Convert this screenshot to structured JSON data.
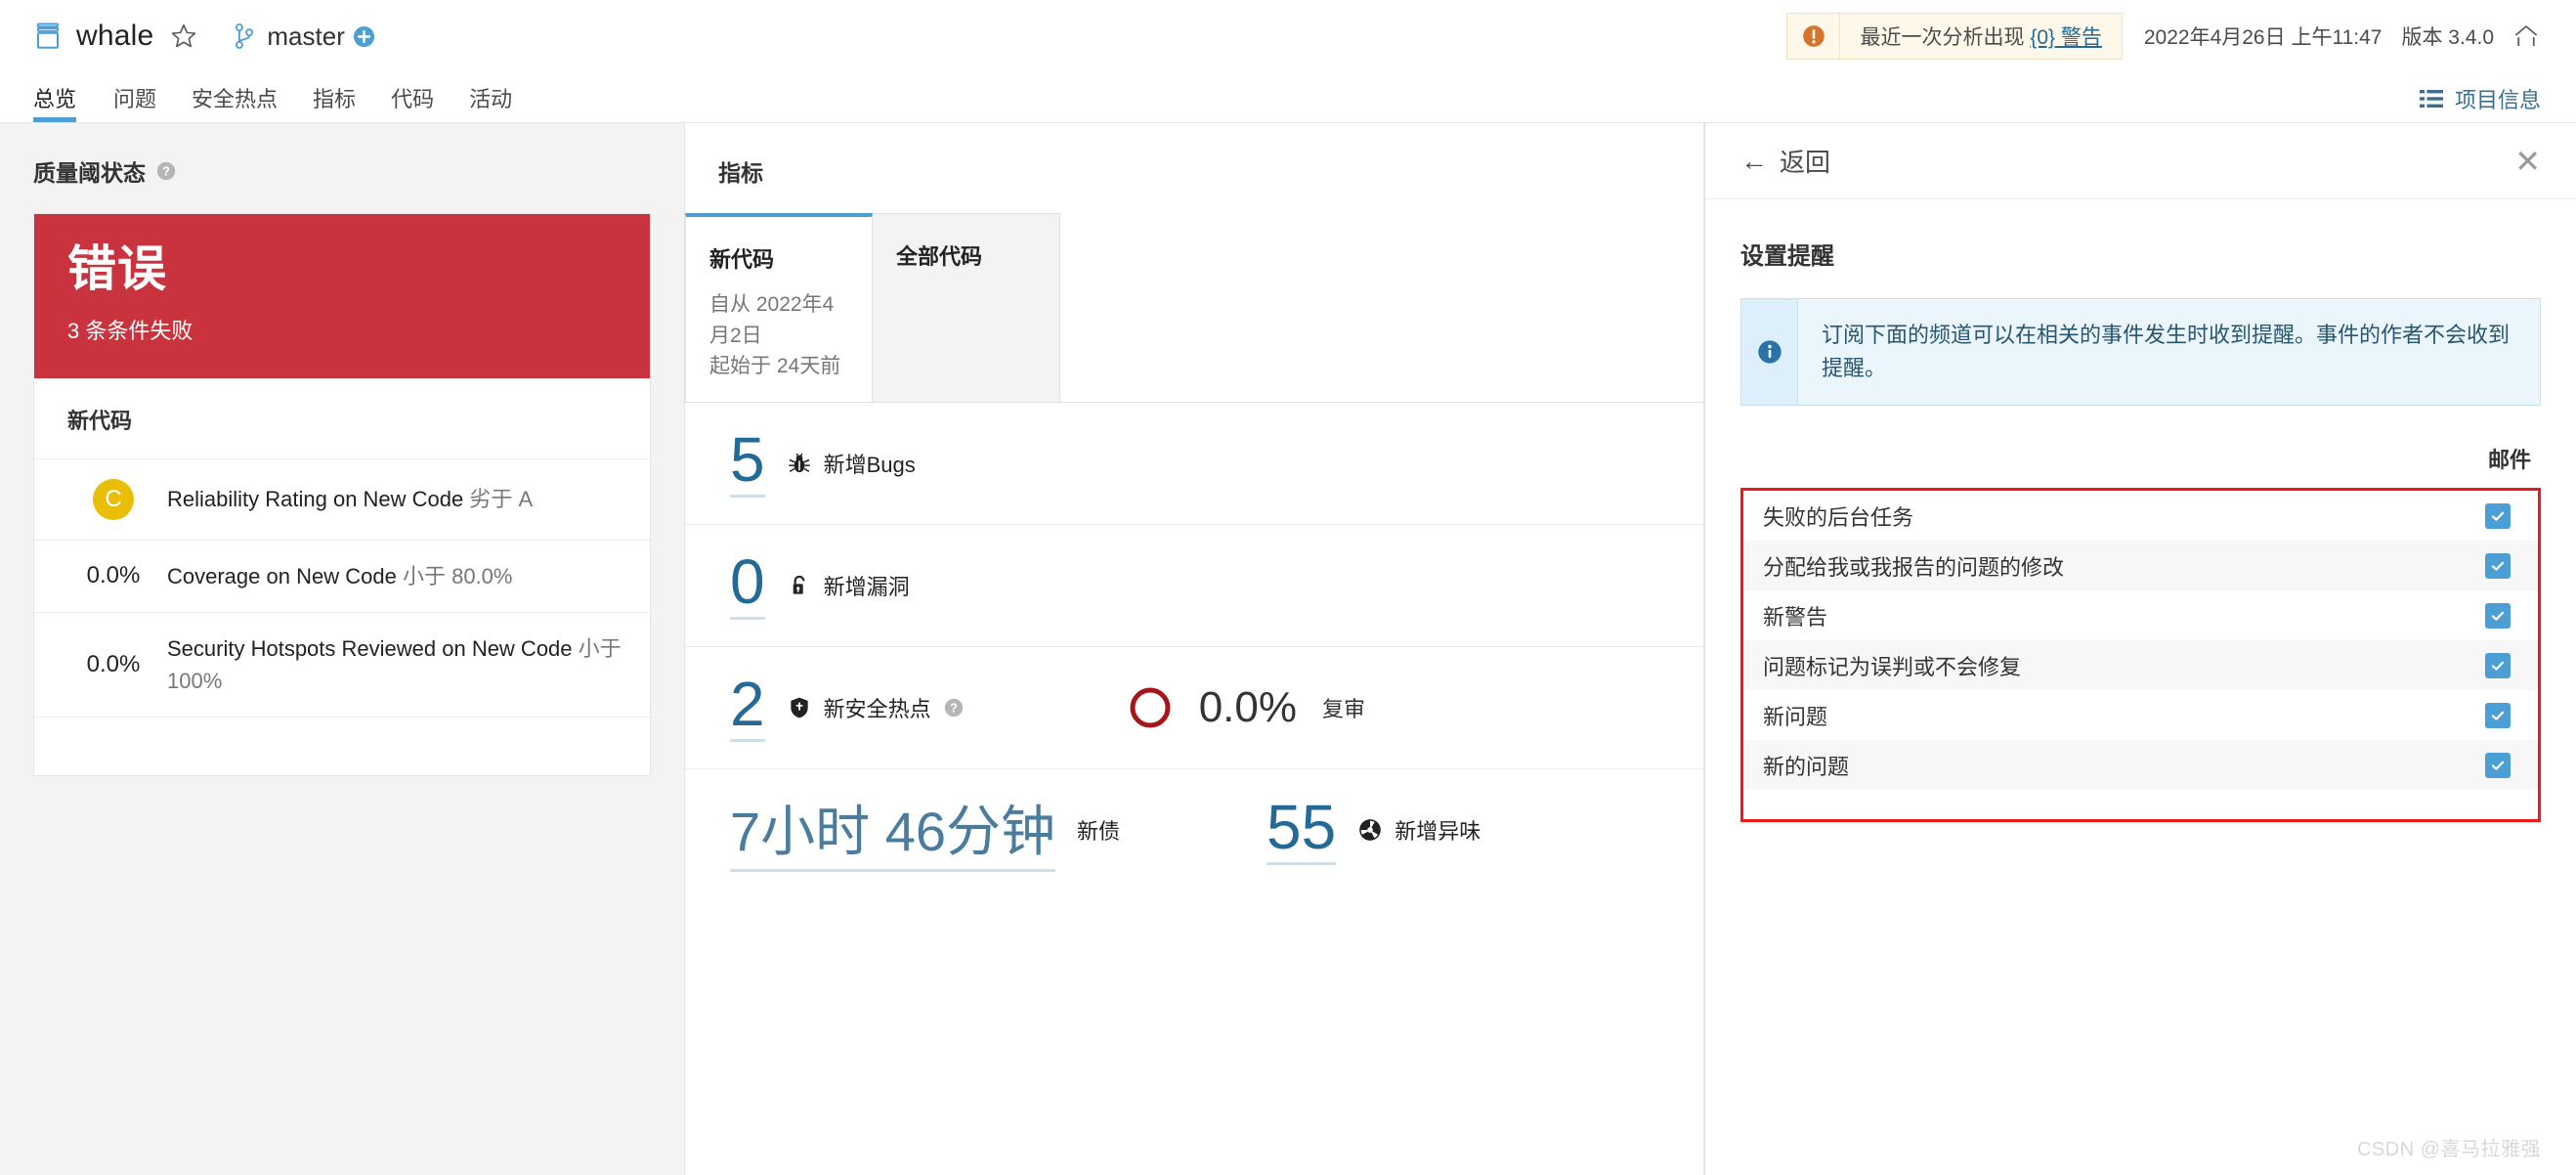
{
  "header": {
    "project_icon": "project-icon",
    "project_name": "whale",
    "favorite_icon": "star-icon",
    "branch_icon": "branch-icon",
    "branch_name": "master",
    "add_icon": "plus-circle-icon",
    "warning_icon": "warning-icon",
    "warning_text_prefix": "最近一次分析出现 ",
    "warning_link": "{0} 警告",
    "analysis_date": "2022年4月26日 上午11:47",
    "version_label": "版本 3.4.0",
    "home_icon": "home-icon"
  },
  "nav": {
    "tabs": [
      {
        "label": "总览",
        "active": true
      },
      {
        "label": "问题",
        "active": false
      },
      {
        "label": "安全热点",
        "active": false
      },
      {
        "label": "指标",
        "active": false
      },
      {
        "label": "代码",
        "active": false
      },
      {
        "label": "活动",
        "active": false
      }
    ],
    "project_info_label": "项目信息",
    "project_info_icon": "list-icon"
  },
  "quality_gate": {
    "section_title": "质量阈状态",
    "help_icon": "help-icon",
    "status": "错误",
    "status_color": "#c9333e",
    "failed_summary": "3 条条件失败",
    "group_title": "新代码",
    "conditions": [
      {
        "value": "C",
        "value_type": "rating",
        "rating_color": "#eabe06",
        "metric": "Reliability Rating on New Code",
        "operator": "劣于",
        "threshold": "A"
      },
      {
        "value": "0.0%",
        "value_type": "number",
        "metric": "Coverage on New Code",
        "operator": "小于",
        "threshold": "80.0%"
      },
      {
        "value": "0.0%",
        "value_type": "number",
        "metric": "Security Hotspots Reviewed on New Code",
        "operator": "小于",
        "threshold": "100%"
      }
    ]
  },
  "measures": {
    "section_title": "指标",
    "period_tabs": [
      {
        "title": "新代码",
        "line1": "自从 2022年4月2日",
        "line2": "起始于 24天前",
        "active": true
      },
      {
        "title": "全部代码",
        "line1": "",
        "line2": "",
        "active": false
      }
    ],
    "rows": [
      {
        "value": "5",
        "icon": "bug-icon",
        "label": "新增Bugs",
        "help": false,
        "right": null
      },
      {
        "value": "0",
        "icon": "vulnerability-icon",
        "label": "新增漏洞",
        "help": false,
        "right": null
      },
      {
        "value": "2",
        "icon": "security-hotspot-icon",
        "label": "新安全热点",
        "help": true,
        "help_icon": "help-icon",
        "right": {
          "donut_icon": "donut-chart-icon",
          "donut_color": "#a4161a",
          "percent": "0.0%",
          "label": "复审"
        }
      }
    ],
    "debt": {
      "value": "7小时 46分钟",
      "label": "新债"
    },
    "code_smells": {
      "value": "55",
      "icon": "code-smell-icon",
      "label": "新增异味"
    }
  },
  "notifications_panel": {
    "back_label": "返回",
    "back_icon": "arrow-left-icon",
    "close_icon": "close-icon",
    "title": "设置提醒",
    "info_icon": "info-icon",
    "info_text": "订阅下面的频道可以在相关的事件发生时收到提醒。事件的作者不会收到提醒。",
    "channel_header": "邮件",
    "items": [
      {
        "label": "失败的后台任务",
        "checked": true
      },
      {
        "label": "分配给我或我报告的问题的修改",
        "checked": true
      },
      {
        "label": "新警告",
        "checked": true
      },
      {
        "label": "问题标记为误判或不会修复",
        "checked": true
      },
      {
        "label": "新问题",
        "checked": true
      },
      {
        "label": "新的问题",
        "checked": true
      }
    ],
    "highlight_color": "#f01818"
  },
  "watermark": "CSDN @喜马拉雅强"
}
